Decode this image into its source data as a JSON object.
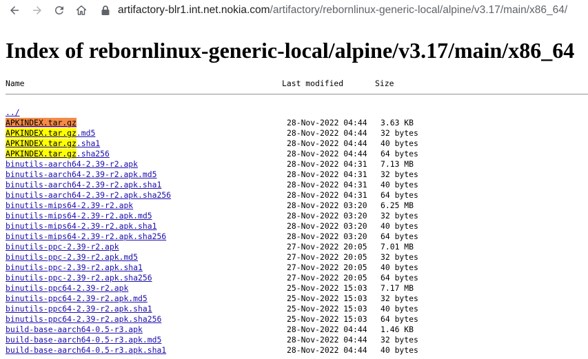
{
  "browser": {
    "url_host": "artifactory-blr1.int.net.nokia.com",
    "url_path": "/artifactory/rebornlinux-generic-local/alpine/v3.17/main/x86_64/",
    "icons": [
      "back-icon",
      "forward-icon",
      "reload-icon",
      "home-icon",
      "lock-icon"
    ]
  },
  "page": {
    "title": "Index of rebornlinux-generic-local/alpine/v3.17/main/x86_64",
    "columns": {
      "name": "Name",
      "modified": "Last modified",
      "size": "Size"
    },
    "parent_link": "../",
    "highlight_term": ".tar.gz",
    "colors": {
      "link": "#1a0dab",
      "highlight_current": "#f48a46",
      "highlight_match": "#ffff00"
    }
  },
  "files": [
    {
      "name": "APKINDEX.tar.gz",
      "modified": "28-Nov-2022 04:44",
      "size": "3.63 KB",
      "hl": "orange"
    },
    {
      "name": "APKINDEX.tar.gz.md5",
      "modified": "28-Nov-2022 04:44",
      "size": "32 bytes",
      "hl": "yellow"
    },
    {
      "name": "APKINDEX.tar.gz.sha1",
      "modified": "28-Nov-2022 04:44",
      "size": "40 bytes",
      "hl": "yellow"
    },
    {
      "name": "APKINDEX.tar.gz.sha256",
      "modified": "28-Nov-2022 04:44",
      "size": "64 bytes",
      "hl": "yellow"
    },
    {
      "name": "binutils-aarch64-2.39-r2.apk",
      "modified": "28-Nov-2022 04:31",
      "size": "7.13 MB"
    },
    {
      "name": "binutils-aarch64-2.39-r2.apk.md5",
      "modified": "28-Nov-2022 04:31",
      "size": "32 bytes"
    },
    {
      "name": "binutils-aarch64-2.39-r2.apk.sha1",
      "modified": "28-Nov-2022 04:31",
      "size": "40 bytes"
    },
    {
      "name": "binutils-aarch64-2.39-r2.apk.sha256",
      "modified": "28-Nov-2022 04:31",
      "size": "64 bytes"
    },
    {
      "name": "binutils-mips64-2.39-r2.apk",
      "modified": "28-Nov-2022 03:20",
      "size": "6.25 MB"
    },
    {
      "name": "binutils-mips64-2.39-r2.apk.md5",
      "modified": "28-Nov-2022 03:20",
      "size": "32 bytes"
    },
    {
      "name": "binutils-mips64-2.39-r2.apk.sha1",
      "modified": "28-Nov-2022 03:20",
      "size": "40 bytes"
    },
    {
      "name": "binutils-mips64-2.39-r2.apk.sha256",
      "modified": "28-Nov-2022 03:20",
      "size": "64 bytes"
    },
    {
      "name": "binutils-ppc-2.39-r2.apk",
      "modified": "27-Nov-2022 20:05",
      "size": "7.01 MB"
    },
    {
      "name": "binutils-ppc-2.39-r2.apk.md5",
      "modified": "27-Nov-2022 20:05",
      "size": "32 bytes"
    },
    {
      "name": "binutils-ppc-2.39-r2.apk.sha1",
      "modified": "27-Nov-2022 20:05",
      "size": "40 bytes"
    },
    {
      "name": "binutils-ppc-2.39-r2.apk.sha256",
      "modified": "27-Nov-2022 20:05",
      "size": "64 bytes"
    },
    {
      "name": "binutils-ppc64-2.39-r2.apk",
      "modified": "25-Nov-2022 15:03",
      "size": "7.17 MB"
    },
    {
      "name": "binutils-ppc64-2.39-r2.apk.md5",
      "modified": "25-Nov-2022 15:03",
      "size": "32 bytes"
    },
    {
      "name": "binutils-ppc64-2.39-r2.apk.sha1",
      "modified": "25-Nov-2022 15:03",
      "size": "40 bytes"
    },
    {
      "name": "binutils-ppc64-2.39-r2.apk.sha256",
      "modified": "25-Nov-2022 15:03",
      "size": "64 bytes"
    },
    {
      "name": "build-base-aarch64-0.5-r3.apk",
      "modified": "28-Nov-2022 04:44",
      "size": "1.46 KB"
    },
    {
      "name": "build-base-aarch64-0.5-r3.apk.md5",
      "modified": "28-Nov-2022 04:44",
      "size": "32 bytes"
    },
    {
      "name": "build-base-aarch64-0.5-r3.apk.sha1",
      "modified": "28-Nov-2022 04:44",
      "size": "40 bytes"
    }
  ]
}
